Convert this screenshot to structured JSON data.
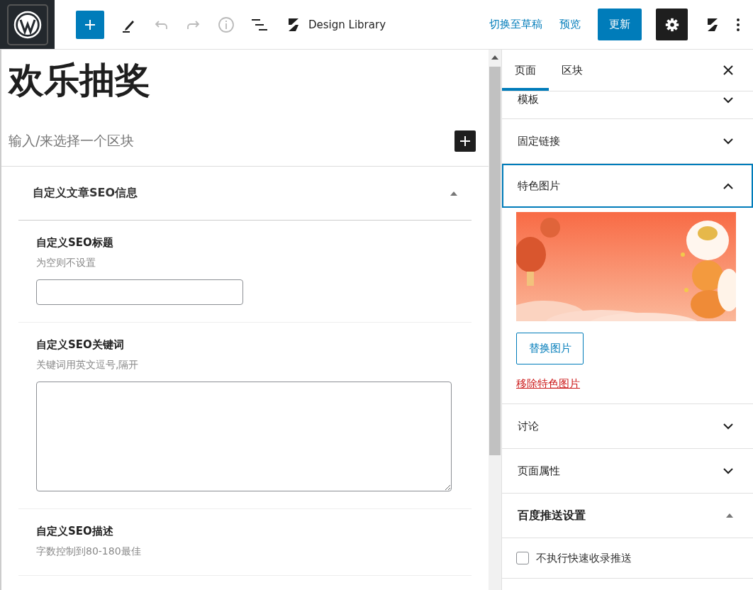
{
  "toolbar": {
    "undo": {
      "disabled": true
    },
    "redo": {
      "disabled": true
    },
    "info": {
      "disabled": true
    },
    "library_label": "Design Library",
    "switch_to_draft": "切换至草稿",
    "preview": "预览",
    "update": "更新",
    "settings": {
      "pressed": true
    }
  },
  "editor": {
    "title": "欢乐抽奖",
    "appender_placeholder": "输入/来选择一个区块",
    "metabox": {
      "title": "自定义文章SEO信息",
      "expanded": true,
      "fields": [
        {
          "label": "自定义SEO标题",
          "hint": "为空则不设置",
          "kind": "input"
        },
        {
          "label": "自定义SEO关键词",
          "hint": "关键词用英文逗号,隔开",
          "kind": "textarea"
        },
        {
          "label": "自定义SEO描述",
          "hint": "字数控制到80-180最佳",
          "kind": "cut"
        }
      ]
    }
  },
  "sidebar": {
    "tabs": [
      {
        "label": "页面",
        "selected": true
      },
      {
        "label": "区块",
        "selected": false
      }
    ],
    "panels": [
      {
        "kind": "panel",
        "title": "模板",
        "expanded": false,
        "focused": false
      },
      {
        "kind": "panel",
        "title": "固定链接",
        "expanded": false,
        "focused": false
      },
      {
        "kind": "featured_image",
        "title": "特色图片",
        "expanded": true,
        "focused": true,
        "replace_button": "替换图片",
        "remove_link": "移除特色图片"
      },
      {
        "kind": "panel",
        "title": "讨论",
        "expanded": false,
        "focused": false
      },
      {
        "kind": "panel",
        "title": "页面属性",
        "expanded": false,
        "focused": false
      },
      {
        "kind": "metabox",
        "title": "百度推送设置",
        "expanded": true,
        "focused": false,
        "checkbox": {
          "label": "不执行快速收录推送",
          "checked": false
        }
      }
    ]
  }
}
